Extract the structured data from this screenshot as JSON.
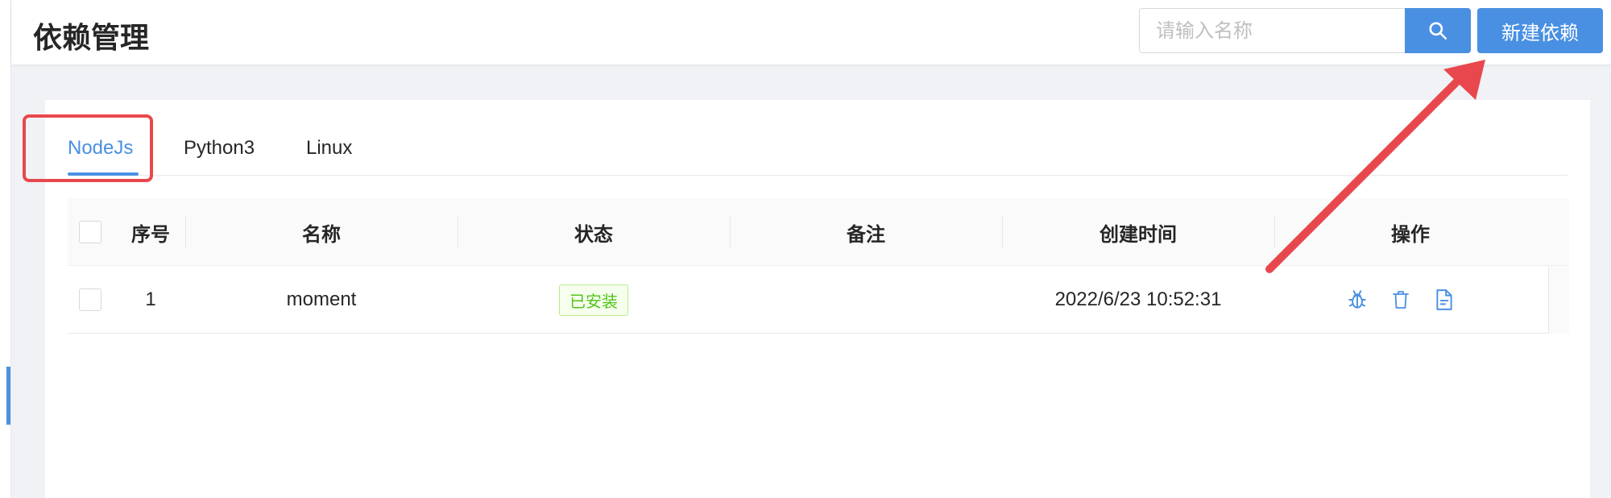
{
  "header": {
    "title": "依赖管理",
    "search_placeholder": "请输入名称",
    "create_label": "新建依赖"
  },
  "tabs": [
    {
      "label": "NodeJs",
      "active": true
    },
    {
      "label": "Python3",
      "active": false
    },
    {
      "label": "Linux",
      "active": false
    }
  ],
  "table": {
    "columns": [
      "序号",
      "名称",
      "状态",
      "备注",
      "创建时间",
      "操作"
    ],
    "rows": [
      {
        "index": "1",
        "name": "moment",
        "status": "已安装",
        "remark": "",
        "created_at": "2022/6/23 10:52:31",
        "actions": [
          "bug-icon",
          "trash-icon",
          "file-text-icon"
        ]
      }
    ]
  },
  "colors": {
    "primary": "#4a90e2",
    "annotation": "#e8484d",
    "success": "#52c41a"
  }
}
